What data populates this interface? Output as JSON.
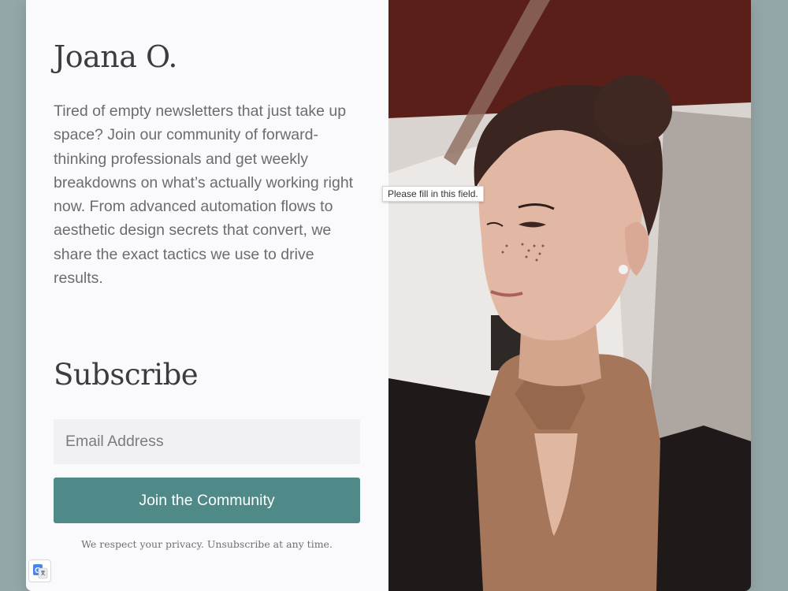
{
  "profile": {
    "name": "Joana O.",
    "intro": "Tired of empty newsletters that just take up space? Join our community of forward-thinking professionals and get weekly breakdowns on what’s actually working right now. From advanced automation flows to aesthetic design secrets that convert, we share the exact tactics we use to drive results."
  },
  "subscribe": {
    "heading": "Subscribe",
    "email_placeholder": "Email Address",
    "email_value": "",
    "button_label": "Join the Community",
    "privacy_note": "We respect your privacy. Unsubscribe at any time."
  },
  "validation": {
    "tooltip": "Please fill in this field."
  },
  "colors": {
    "page_background": "#94a6a8",
    "card_background": "#fafafc",
    "button": "#4f8a88",
    "input_background": "#f1f1f4",
    "heading_text": "#3c3c3e",
    "body_text": "#6c6c70"
  },
  "icons": {
    "translate": "google-translate-icon"
  }
}
